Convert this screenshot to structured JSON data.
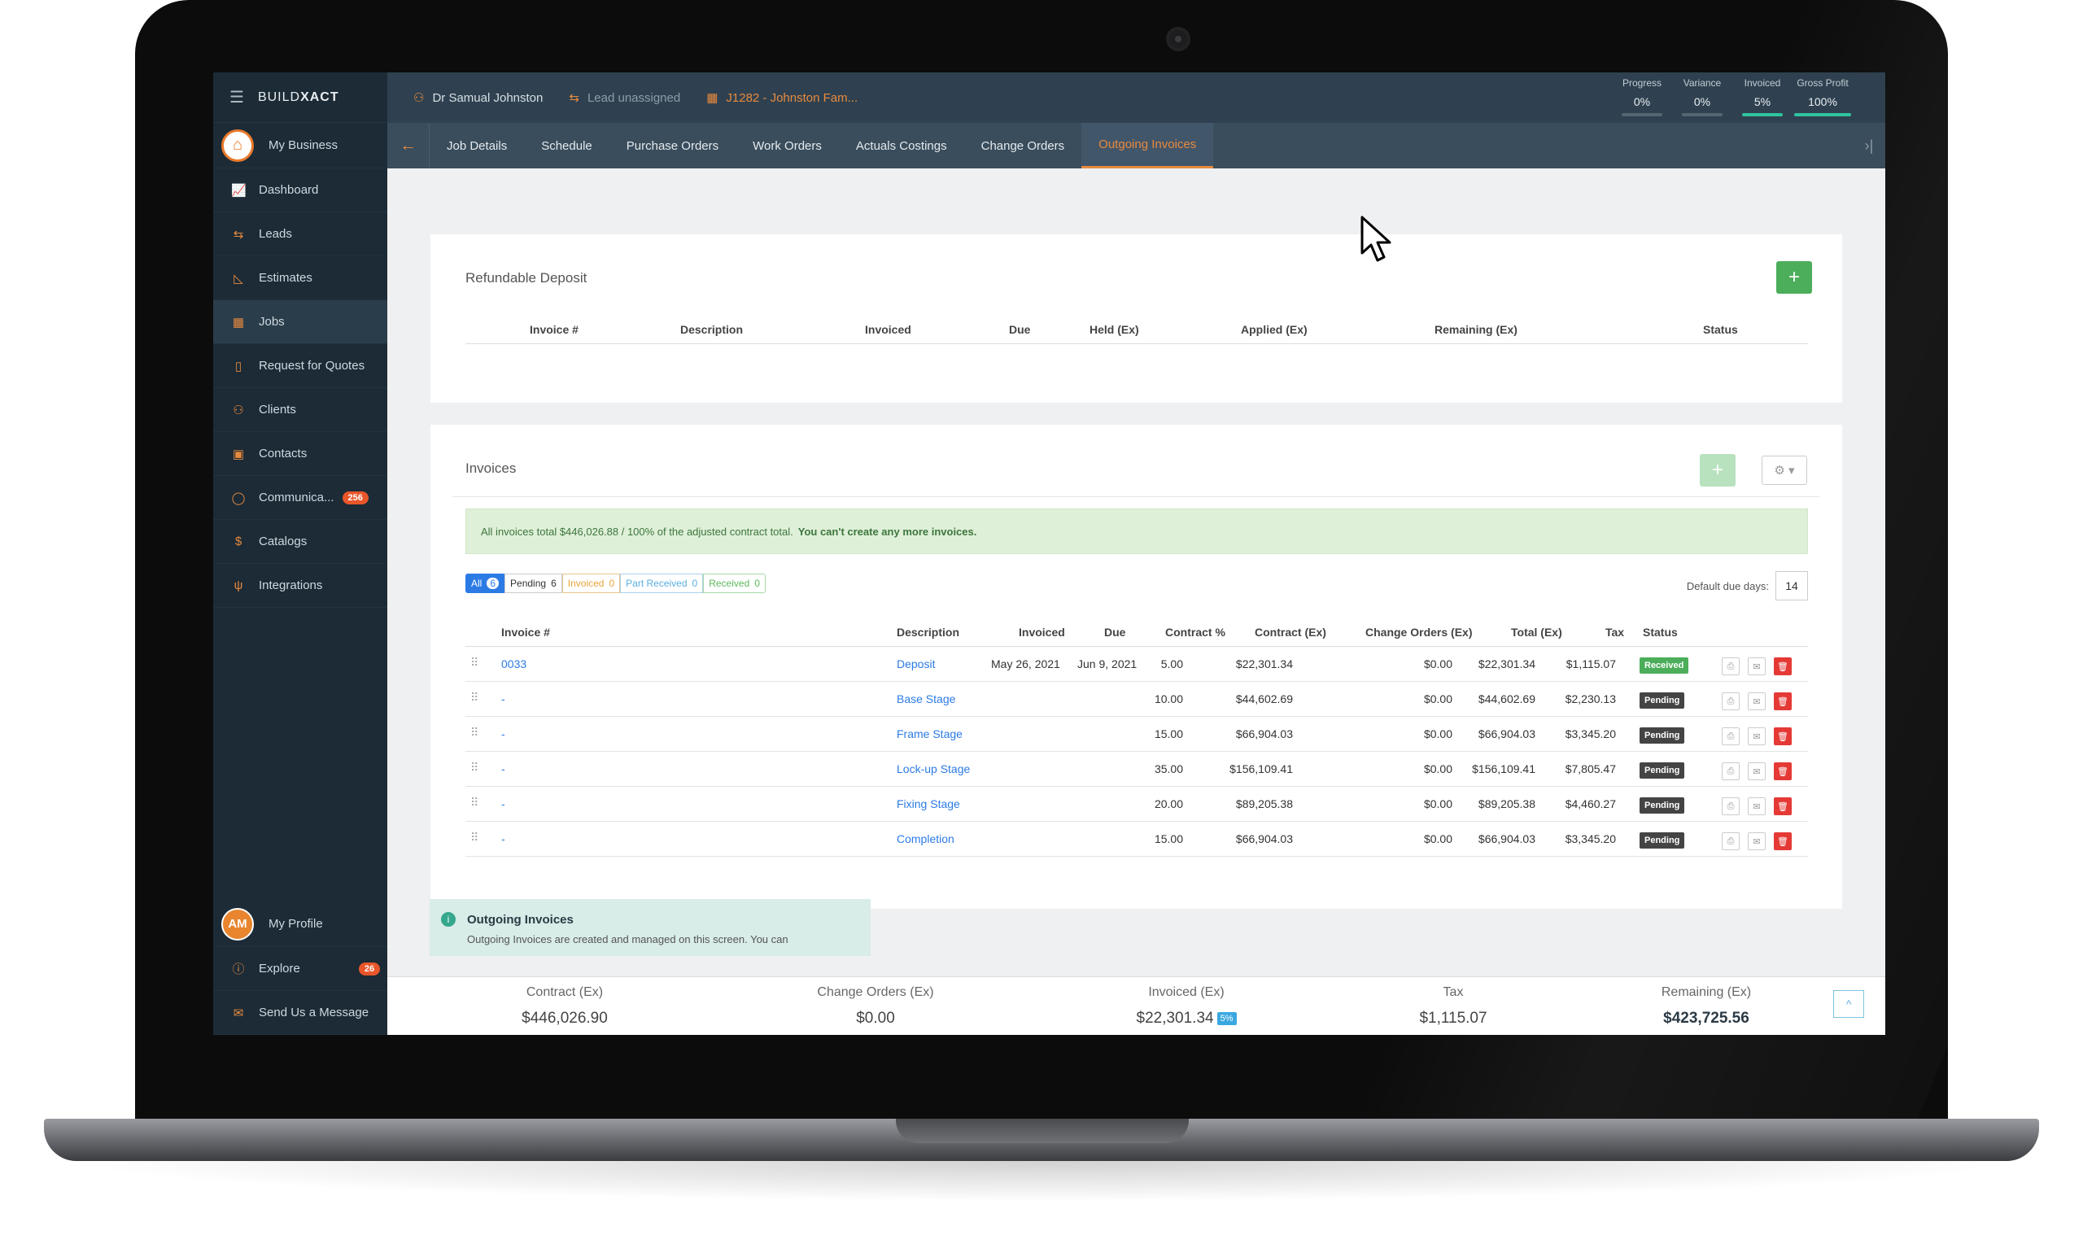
{
  "app": {
    "brand_prefix": "BUILD",
    "brand_suffix": "XACT"
  },
  "sidebar": {
    "business": "My Business",
    "items": [
      {
        "label": "Dashboard",
        "icon": "chart-icon"
      },
      {
        "label": "Leads",
        "icon": "arrows-icon"
      },
      {
        "label": "Estimates",
        "icon": "ruler-icon"
      },
      {
        "label": "Jobs",
        "icon": "calendar-icon"
      },
      {
        "label": "Request for Quotes",
        "icon": "document-icon"
      },
      {
        "label": "Clients",
        "icon": "person-icon"
      },
      {
        "label": "Contacts",
        "icon": "contact-card-icon"
      },
      {
        "label": "Communica...",
        "icon": "chat-icon",
        "badge": "256"
      },
      {
        "label": "Catalogs",
        "icon": "dollar-icon"
      },
      {
        "label": "Integrations",
        "icon": "plug-icon"
      }
    ],
    "bottom": {
      "profile_initials": "AM",
      "profile_label": "My Profile",
      "explore_label": "Explore",
      "explore_badge": "26",
      "message_label": "Send Us a Message"
    }
  },
  "topbar": {
    "client": "Dr Samual Johnston",
    "lead": "Lead unassigned",
    "job": "J1282 - Johnston Fam...",
    "stats": [
      {
        "label": "Progress",
        "value": "0%"
      },
      {
        "label": "Variance",
        "value": "0%"
      },
      {
        "label": "Invoiced",
        "value": "5%"
      },
      {
        "label": "Gross Profit",
        "value": "100%"
      }
    ]
  },
  "tabs": [
    "Job Details",
    "Schedule",
    "Purchase Orders",
    "Work Orders",
    "Actuals Costings",
    "Change Orders",
    "Outgoing Invoices"
  ],
  "active_tab": "Outgoing Invoices",
  "deposit": {
    "title": "Refundable Deposit",
    "add_label": "+",
    "columns": [
      "Invoice #",
      "Description",
      "Invoiced",
      "Due",
      "Held (Ex)",
      "Applied (Ex)",
      "Remaining (Ex)",
      "Status"
    ]
  },
  "invoices": {
    "title": "Invoices",
    "add_label": "+",
    "gear_label": "⚙ ▾",
    "alert_text": "All invoices total $446,026.88 / 100% of the adjusted contract total.",
    "alert_bold": "You can't create any more invoices.",
    "filters": {
      "all": "All",
      "all_count": "6",
      "pending": "Pending",
      "pending_count": "6",
      "invoiced": "Invoiced",
      "invoiced_count": "0",
      "part_received": "Part Received",
      "part_received_count": "0",
      "received": "Received",
      "received_count": "0"
    },
    "due_days_label": "Default due days:",
    "due_days_value": "14",
    "columns": {
      "invoice_no": "Invoice #",
      "description": "Description",
      "invoiced": "Invoiced",
      "due": "Due",
      "contract_pct": "Contract %",
      "contract_ex": "Contract (Ex)",
      "change_orders_ex": "Change Orders (Ex)",
      "total_ex": "Total (Ex)",
      "tax": "Tax",
      "status": "Status"
    },
    "rows": [
      {
        "invoice_no": "0033",
        "description": "Deposit",
        "invoiced": "May 26, 2021",
        "due": "Jun 9, 2021",
        "contract_pct": "5.00",
        "contract_ex": "$22,301.34",
        "change_orders_ex": "$0.00",
        "total_ex": "$22,301.34",
        "tax": "$1,115.07",
        "status": "Received"
      },
      {
        "invoice_no": "-",
        "description": "Base Stage",
        "invoiced": "",
        "due": "",
        "contract_pct": "10.00",
        "contract_ex": "$44,602.69",
        "change_orders_ex": "$0.00",
        "total_ex": "$44,602.69",
        "tax": "$2,230.13",
        "status": "Pending"
      },
      {
        "invoice_no": "-",
        "description": "Frame Stage",
        "invoiced": "",
        "due": "",
        "contract_pct": "15.00",
        "contract_ex": "$66,904.03",
        "change_orders_ex": "$0.00",
        "total_ex": "$66,904.03",
        "tax": "$3,345.20",
        "status": "Pending"
      },
      {
        "invoice_no": "-",
        "description": "Lock-up Stage",
        "invoiced": "",
        "due": "",
        "contract_pct": "35.00",
        "contract_ex": "$156,109.41",
        "change_orders_ex": "$0.00",
        "total_ex": "$156,109.41",
        "tax": "$7,805.47",
        "status": "Pending"
      },
      {
        "invoice_no": "-",
        "description": "Fixing Stage",
        "invoiced": "",
        "due": "",
        "contract_pct": "20.00",
        "contract_ex": "$89,205.38",
        "change_orders_ex": "$0.00",
        "total_ex": "$89,205.38",
        "tax": "$4,460.27",
        "status": "Pending"
      },
      {
        "invoice_no": "-",
        "description": "Completion",
        "invoiced": "",
        "due": "",
        "contract_pct": "15.00",
        "contract_ex": "$66,904.03",
        "change_orders_ex": "$0.00",
        "total_ex": "$66,904.03",
        "tax": "$3,345.20",
        "status": "Pending"
      }
    ]
  },
  "info": {
    "title": "Outgoing Invoices",
    "text": "Outgoing Invoices are created and managed on this screen. You can"
  },
  "totals": {
    "contract_label": "Contract (Ex)",
    "contract_value": "$446,026.90",
    "change_orders_label": "Change Orders (Ex)",
    "change_orders_value": "$0.00",
    "invoiced_label": "Invoiced (Ex)",
    "invoiced_value": "$22,301.34",
    "invoiced_pct": "5%",
    "tax_label": "Tax",
    "tax_value": "$1,115.07",
    "remaining_label": "Remaining (Ex)",
    "remaining_value": "$423,725.56"
  },
  "colors": {
    "accent": "#e88a3e",
    "sidebar": "#1c2b36",
    "link": "#2c7be5",
    "success": "#4cae5b",
    "danger": "#e53935"
  }
}
